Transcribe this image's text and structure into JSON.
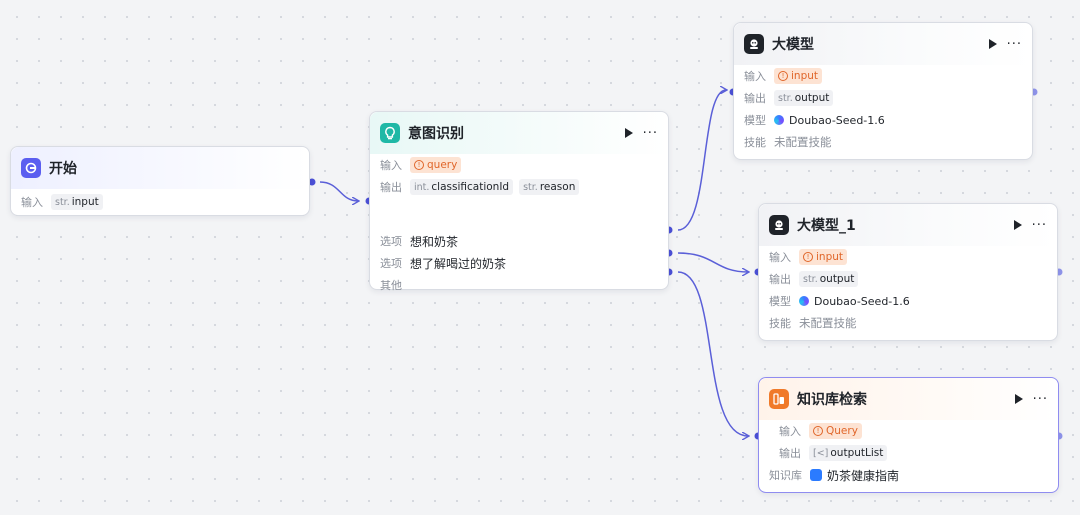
{
  "nodes": {
    "start": {
      "title": "开始",
      "input_label": "输入",
      "input_type": "str.",
      "input_name": "input"
    },
    "intent": {
      "title": "意图识别",
      "input_label": "输入",
      "input_name": "query",
      "output_label": "输出",
      "outputs": [
        {
          "type": "int.",
          "name": "classificationId"
        },
        {
          "type": "str.",
          "name": "reason"
        }
      ],
      "option_label": "选项",
      "options": [
        "想和奶茶",
        "想了解喝过的奶茶"
      ],
      "other_label": "其他"
    },
    "llm1": {
      "title": "大模型",
      "input_label": "输入",
      "input_name": "input",
      "output_label": "输出",
      "output_type": "str.",
      "output_name": "output",
      "model_label": "模型",
      "model_name": "Doubao-Seed-1.6",
      "skill_label": "技能",
      "skill_value": "未配置技能"
    },
    "llm2": {
      "title": "大模型_1",
      "input_label": "输入",
      "input_name": "input",
      "output_label": "输出",
      "output_type": "str.",
      "output_name": "output",
      "model_label": "模型",
      "model_name": "Doubao-Seed-1.6",
      "skill_label": "技能",
      "skill_value": "未配置技能"
    },
    "kb": {
      "title": "知识库检索",
      "input_label": "输入",
      "input_name": "Query",
      "output_label": "输出",
      "output_type": "[<]",
      "output_name": "outputList",
      "kb_label": "知识库",
      "kb_name": "奶茶健康指南"
    }
  },
  "colors": {
    "edge": "#5a5fd8",
    "port": "#4b50d6",
    "port_idle": "#8f94ea",
    "warn": "#e0662a",
    "selected_border": "#8f8cf0"
  },
  "icons": [
    "start-icon",
    "llm-icon",
    "intent-icon",
    "knowledge-icon",
    "play-icon",
    "more-icon",
    "warning-icon",
    "model-logo-icon",
    "knowledge-base-icon"
  ]
}
